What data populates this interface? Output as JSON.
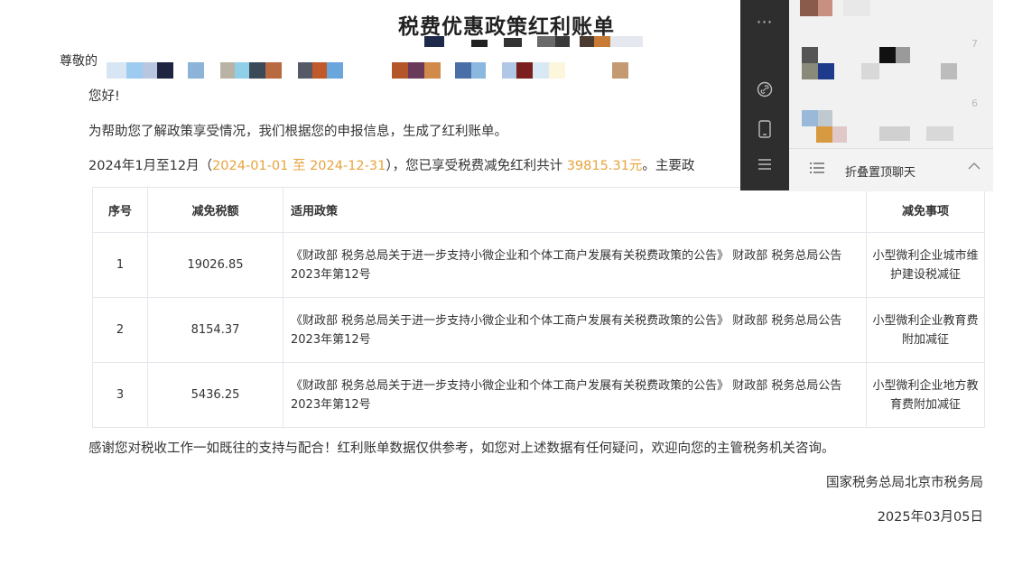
{
  "document": {
    "title": "税费优惠政策红利账单",
    "salutation_visible": "尊敬的",
    "hello": "您好!",
    "intro": "为帮助您了解政策享受情况，我们根据您的申报信息，生成了红利账单。",
    "period": {
      "prefix": "2024年1月至12月",
      "open_paren": "（",
      "range": "2024-01-01 至 2024-12-31",
      "close_paren": "），您已享受税费减免红利共计",
      "total": "39815.31元",
      "suffix": "。主要政"
    },
    "table": {
      "headers": [
        "序号",
        "减免税额",
        "适用政策",
        "减免事项"
      ],
      "rows": [
        {
          "no": "1",
          "amount": "19026.85",
          "policy": "《财政部 税务总局关于进一步支持小微企业和个体工商户发展有关税费政策的公告》 财政部 税务总局公告2023年第12号",
          "item": "小型微利企业城市维护建设税减征"
        },
        {
          "no": "2",
          "amount": "8154.37",
          "policy": "《财政部 税务总局关于进一步支持小微企业和个体工商户发展有关税费政策的公告》 财政部 税务总局公告2023年第12号",
          "item": "小型微利企业教育费附加减征"
        },
        {
          "no": "3",
          "amount": "5436.25",
          "policy": "《财政部 税务总局关于进一步支持小微企业和个体工商户发展有关税费政策的公告》 财政部 税务总局公告2023年第12号",
          "item": "小型微利企业地方教育费附加减征"
        }
      ]
    },
    "thanks": "感谢您对税收工作一如既往的支持与配合！红利账单数据仅供参考，如您对上述数据有任何疑问，欢迎向您的主管税务机关咨询。",
    "issuer": "国家税务总局北京市税务局",
    "date": "2025年03月05日"
  },
  "chat_overlay": {
    "more_icon": "more-dots-icon",
    "link_icon": "link-icon",
    "phone_icon": "phone-icon",
    "menu_icon": "menu-icon",
    "fold_label": "折叠置顶聊天",
    "side_digits": [
      "7",
      "6"
    ]
  },
  "colors": {
    "accent": "#e8a33c",
    "overlay_dark": "#2e2e2e",
    "overlay_light": "#f1f1f1"
  }
}
